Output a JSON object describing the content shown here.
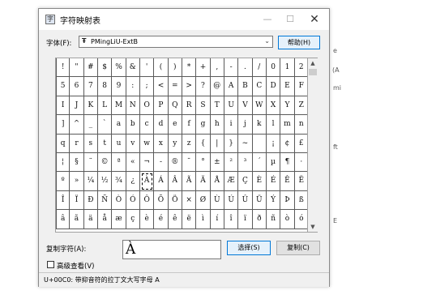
{
  "window": {
    "title": "字符映射表",
    "minimize_label": "—",
    "maximize_label": "☐",
    "close_label": "✕"
  },
  "font_row": {
    "label": "字体(F):",
    "font_icon": "Ŧ",
    "selected_font": "PMingLiU-ExtB",
    "dropdown_arrow": "⌄",
    "help_button": "帮助(H)"
  },
  "characters": [
    [
      "!",
      "\"",
      "#",
      "$",
      "%",
      "&",
      "'",
      "(",
      ")",
      "*",
      "+",
      ",",
      "-",
      ".",
      "/",
      "0",
      "1",
      "2",
      "3",
      "4"
    ],
    [
      "5",
      "6",
      "7",
      "8",
      "9",
      ":",
      ";",
      "<",
      "=",
      ">",
      "?",
      "@",
      "A",
      "B",
      "C",
      "D",
      "E",
      "F",
      "G",
      "H"
    ],
    [
      "I",
      "J",
      "K",
      "L",
      "M",
      "N",
      "O",
      "P",
      "Q",
      "R",
      "S",
      "T",
      "U",
      "V",
      "W",
      "X",
      "Y",
      "Z",
      "[",
      "\\"
    ],
    [
      "]",
      "^",
      "_",
      "`",
      "a",
      "b",
      "c",
      "d",
      "e",
      "f",
      "g",
      "h",
      "i",
      "j",
      "k",
      "l",
      "m",
      "n",
      "o",
      "p"
    ],
    [
      "q",
      "r",
      "s",
      "t",
      "u",
      "v",
      "w",
      "x",
      "y",
      "z",
      "{",
      "|",
      "}",
      "~",
      " ",
      "¡",
      "¢",
      "£",
      "¤",
      "¥"
    ],
    [
      "¦",
      "§",
      "¨",
      "©",
      "ª",
      "«",
      "¬",
      "-",
      "®",
      "¯",
      "°",
      "±",
      "²",
      "³",
      "´",
      "µ",
      "¶",
      "·",
      "¸",
      "¹"
    ],
    [
      "º",
      "»",
      "¼",
      "½",
      "¾",
      "¿",
      "À",
      "Á",
      "Â",
      "Ã",
      "Ä",
      "Å",
      "Æ",
      "Ç",
      "È",
      "É",
      "Ê",
      "Ë",
      "Ì",
      "Í"
    ],
    [
      "Î",
      "Ï",
      "Ð",
      "Ñ",
      "Ò",
      "Ó",
      "Ô",
      "Õ",
      "Ö",
      "×",
      "Ø",
      "Ù",
      "Ú",
      "Û",
      "Ü",
      "Ý",
      "Þ",
      "ß",
      "à",
      "á"
    ],
    [
      "â",
      "ã",
      "ä",
      "å",
      "æ",
      "ç",
      "è",
      "é",
      "ê",
      "ë",
      "ì",
      "í",
      "î",
      "ï",
      "ð",
      "ñ",
      "ò",
      "ó",
      "ô",
      "õ"
    ]
  ],
  "selected_char": "À",
  "copy_row": {
    "label": "复制字符(A):",
    "value": "À",
    "select_button": "选择(S)",
    "copy_button": "复制(C)"
  },
  "advanced": {
    "label": "高级查看(V)",
    "checked": false
  },
  "status": "U+00C0: 带抑音符的拉丁文大写字母 A",
  "scrollbar": {
    "up_arrow": "▲",
    "down_arrow": "▼"
  },
  "background_fragments": [
    "e",
    "(A",
    "mi",
    "ft",
    "E"
  ]
}
